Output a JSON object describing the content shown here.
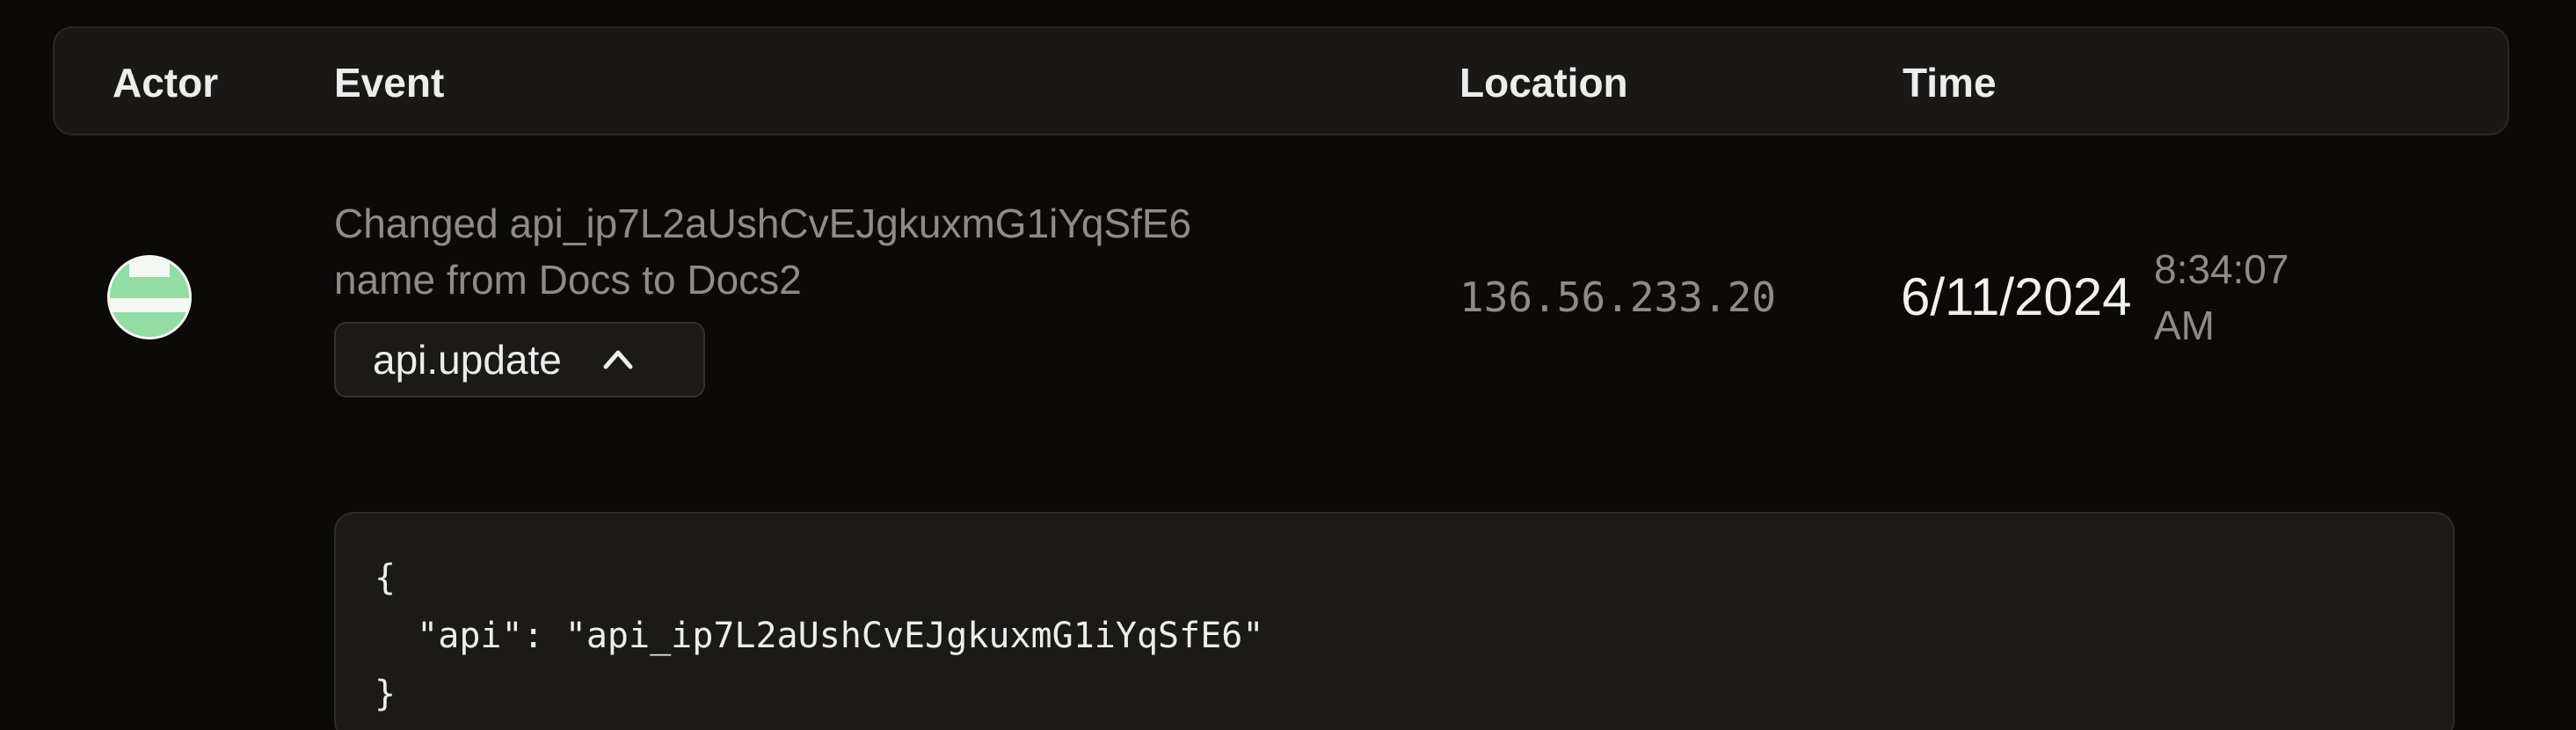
{
  "header": {
    "actor": "Actor",
    "event": "Event",
    "location": "Location",
    "time": "Time"
  },
  "row": {
    "event_description": "Changed api_ip7L2aUshCvEJgkuxmG1iYqSfE6 name from Docs to Docs2",
    "event_type": "api.update",
    "toggle_icon": "chevron-up-icon",
    "location": "136.56.233.20",
    "date": "6/11/2024",
    "time": "8:34:07 AM",
    "avatar_colors": [
      "#93dca4",
      "#f4f8f4"
    ]
  },
  "details": {
    "json_line_1": "{",
    "json_line_2": "  \"api\": \"api_ip7L2aUshCvEJgkuxmG1iYqSfE6\"",
    "json_line_3": "}"
  }
}
